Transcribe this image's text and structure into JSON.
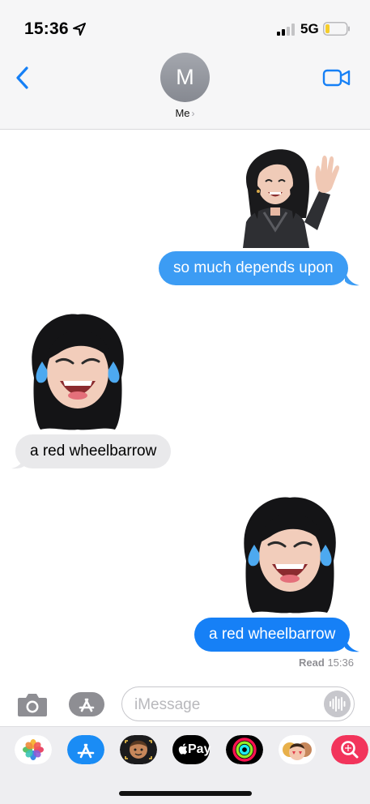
{
  "status_bar": {
    "time": "15:36",
    "network": "5G",
    "battery_level": 0.15
  },
  "header": {
    "avatar_initial": "M",
    "contact_name": "Me",
    "chevron": "›"
  },
  "messages": [
    {
      "direction": "outgoing",
      "sticker": "memoji-waving",
      "text": "so much depends upon"
    },
    {
      "direction": "incoming",
      "sticker": "memoji-laughing-tears",
      "text": "a red wheelbarrow"
    },
    {
      "direction": "outgoing",
      "sticker": "memoji-laughing-tears",
      "text": "a red wheelbarrow"
    }
  ],
  "read_receipt": {
    "label": "Read",
    "time": "15:36"
  },
  "compose": {
    "placeholder": "iMessage"
  },
  "app_drawer": {
    "apps": [
      {
        "name": "photos-app-icon"
      },
      {
        "name": "app-store-app-icon"
      },
      {
        "name": "memoji-stickers-app-icon"
      },
      {
        "name": "apple-pay-app-icon",
        "label": "Pay"
      },
      {
        "name": "activity-app-icon"
      },
      {
        "name": "animoji-app-icon"
      },
      {
        "name": "images-search-app-icon"
      }
    ]
  },
  "colors": {
    "accent": "#1680f6",
    "outgoing_bubble": "#3c9cf4",
    "incoming_bubble": "#e9e9eb",
    "header_bg": "#f6f6f7"
  }
}
